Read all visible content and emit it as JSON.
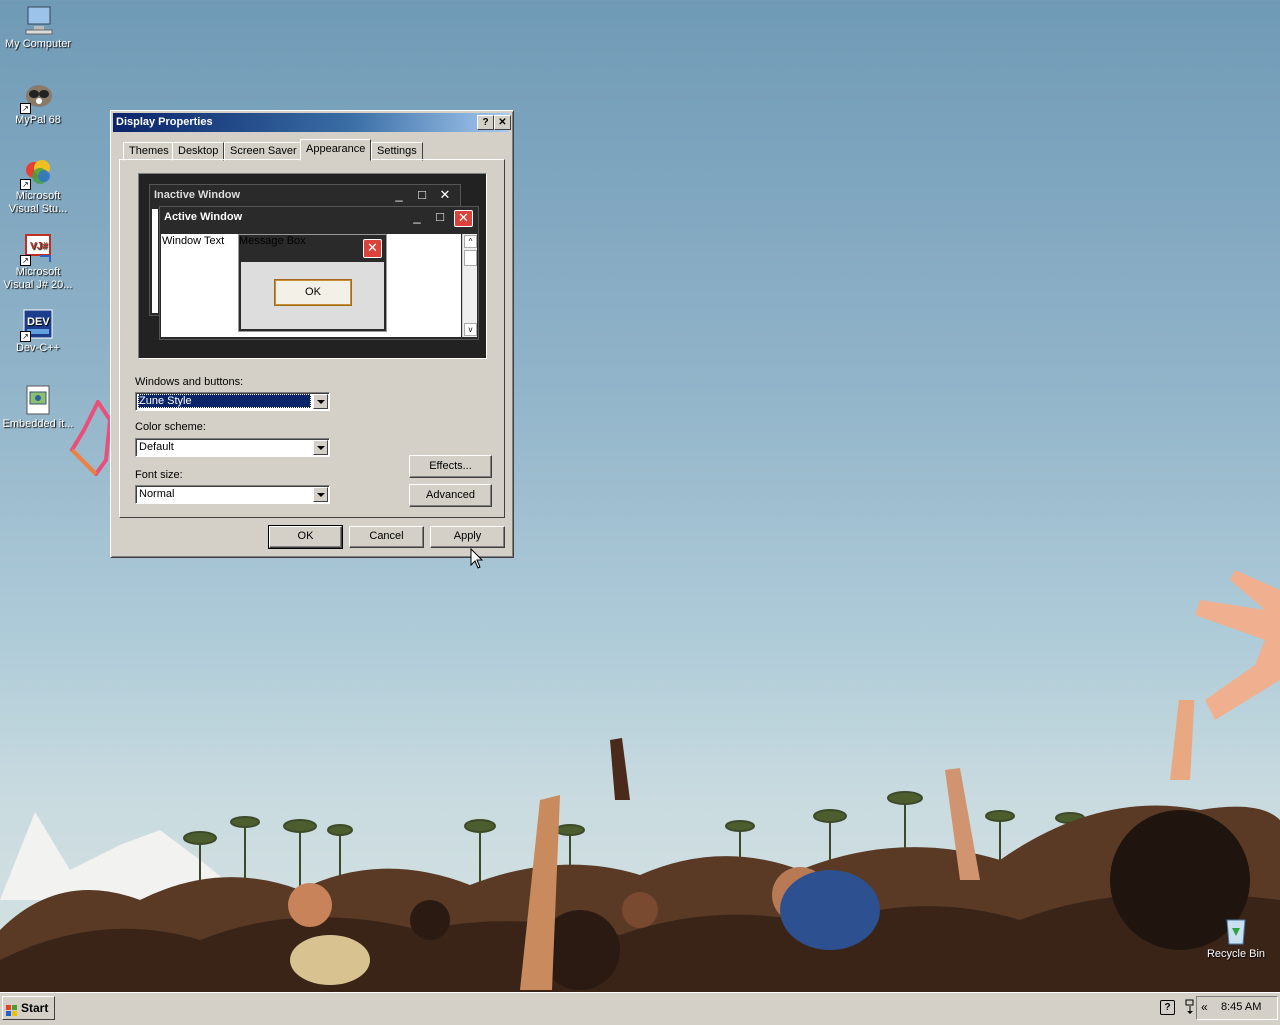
{
  "desktop": {
    "icons": [
      {
        "label": "My Computer",
        "icon": "my-computer-icon"
      },
      {
        "label": "MyPal 68",
        "icon": "mypal-icon"
      },
      {
        "label": "Microsoft Visual Stu...",
        "icon": "visual-studio-icon"
      },
      {
        "label": "Microsoft Visual J# 20...",
        "icon": "visual-jsharp-icon"
      },
      {
        "label": "Dev-C++",
        "icon": "dev-cpp-icon"
      },
      {
        "label": "Embedded it...",
        "icon": "embedded-image-icon"
      },
      {
        "label": "Recycle Bin",
        "icon": "recycle-bin-icon"
      }
    ]
  },
  "dialog": {
    "title": "Display Properties",
    "help_button": "?",
    "close_button": "✕",
    "tabs": [
      "Themes",
      "Desktop",
      "Screen Saver",
      "Appearance",
      "Settings"
    ],
    "active_tab": "Appearance",
    "preview": {
      "inactive_title": "Inactive Window",
      "active_title": "Active Window",
      "window_text": "Window Text",
      "message_title": "Message Box",
      "message_ok": "OK"
    },
    "windows_buttons_label": "Windows and buttons:",
    "windows_buttons_value": "Zune Style",
    "color_scheme_label": "Color scheme:",
    "color_scheme_value": "Default",
    "font_size_label": "Font size:",
    "font_size_value": "Normal",
    "effects_button": "Effects...",
    "advanced_button": "Advanced",
    "ok_button": "OK",
    "cancel_button": "Cancel",
    "apply_button": "Apply"
  },
  "taskbar": {
    "start_label": "Start",
    "clock": "8:45 AM",
    "tray_expand": "«"
  },
  "colors": {
    "title_active": "#0a246a",
    "zune_close": "#d9433b",
    "face": "#d4d0c8"
  }
}
